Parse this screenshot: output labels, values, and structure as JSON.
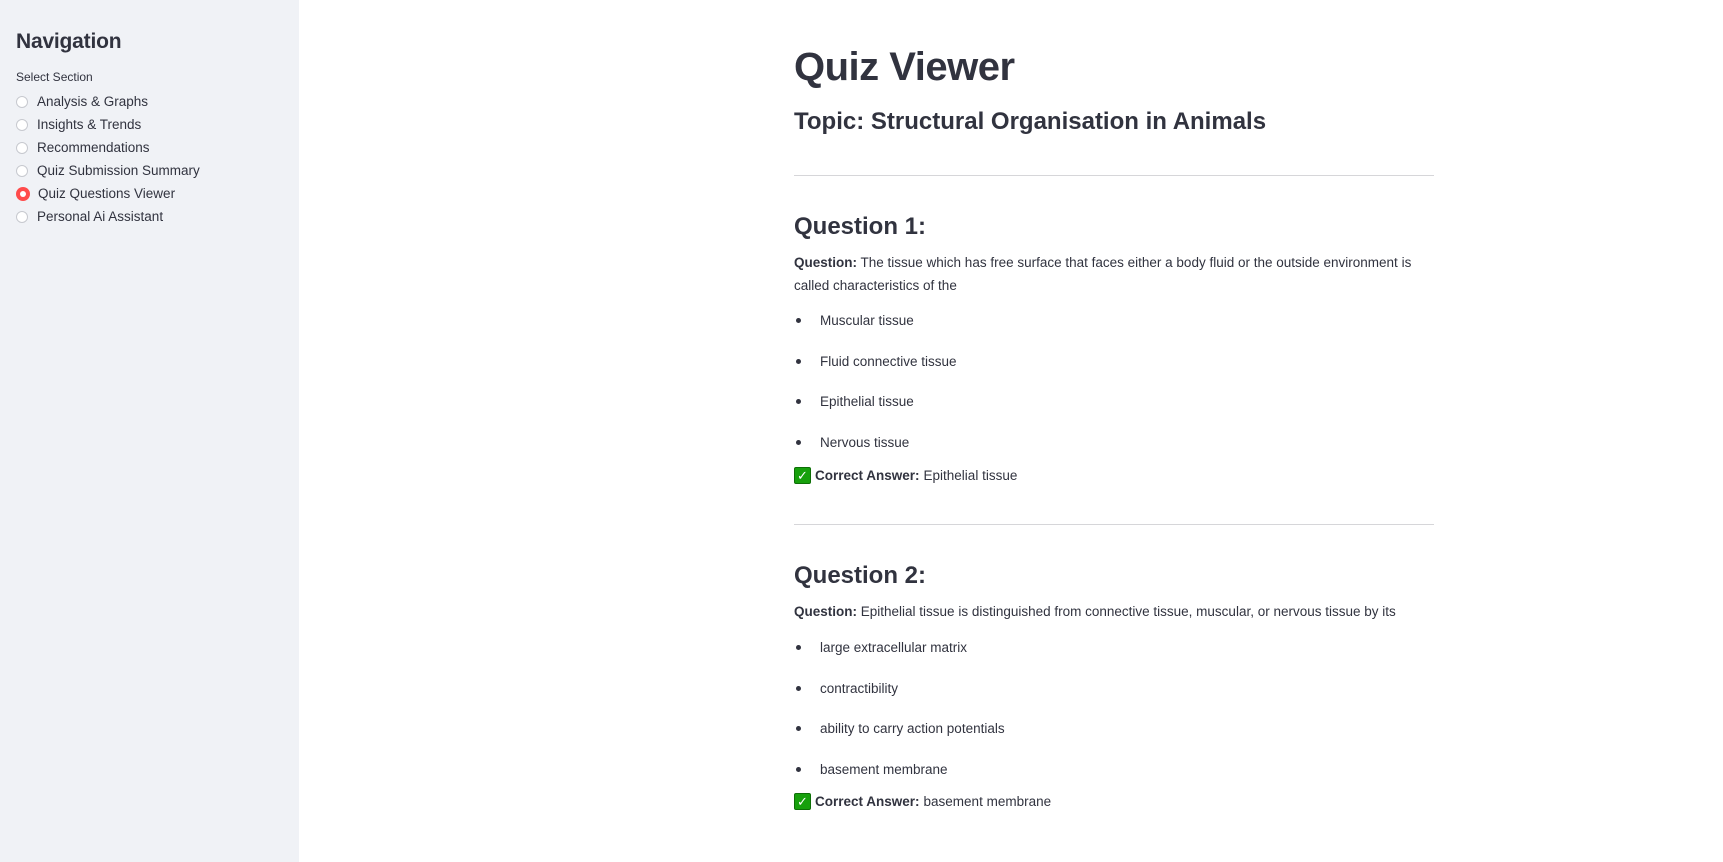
{
  "sidebar": {
    "title": "Navigation",
    "radio_label": "Select Section",
    "options": [
      {
        "label": "Analysis & Graphs",
        "selected": false
      },
      {
        "label": "Insights & Trends",
        "selected": false
      },
      {
        "label": "Recommendations",
        "selected": false
      },
      {
        "label": "Quiz Submission Summary",
        "selected": false
      },
      {
        "label": "Quiz Questions Viewer",
        "selected": true
      },
      {
        "label": "Personal Ai Assistant",
        "selected": false
      }
    ]
  },
  "main": {
    "title": "Quiz Viewer",
    "topic": "Topic: Structural Organisation in Animals",
    "question_prefix": "Question:",
    "answer_prefix": "Correct Answer:",
    "answer_icon": "check-mark-icon",
    "questions": [
      {
        "heading": "Question 1:",
        "text": "The tissue which has free surface that faces either a body fluid or the outside environment is called characteristics of the",
        "options": [
          "Muscular tissue",
          "Fluid connective tissue",
          "Epithelial tissue",
          "Nervous tissue"
        ],
        "answer": "Epithelial tissue"
      },
      {
        "heading": "Question 2:",
        "text": "Epithelial tissue is distinguished from connective tissue, muscular, or nervous tissue by its",
        "options": [
          "large extracellular matrix",
          "contractibility",
          "ability to carry action potentials",
          "basement membrane"
        ],
        "answer": "basement membrane"
      }
    ]
  },
  "colors": {
    "sidebar_bg": "#f0f2f6",
    "accent": "#ff4b4b",
    "text": "#31333f",
    "check_green": "#17a00c"
  }
}
